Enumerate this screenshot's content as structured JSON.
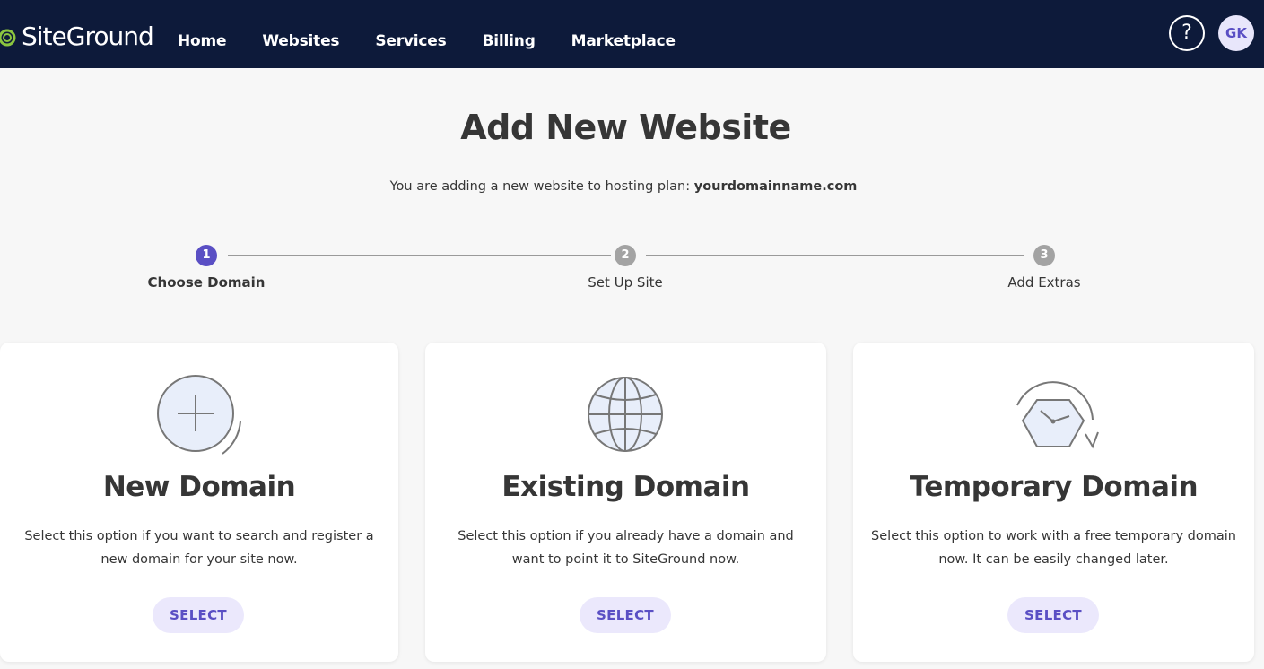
{
  "header": {
    "logo_text": "SiteGround",
    "nav": [
      "Home",
      "Websites",
      "Services",
      "Billing",
      "Marketplace"
    ],
    "help_label": "?",
    "avatar_initials": "GK"
  },
  "page": {
    "title": "Add New Website",
    "subtitle_prefix": "You are adding a new website to hosting plan: ",
    "plan_domain": "yourdomainname.com"
  },
  "steps": [
    {
      "number": "1",
      "label": "Choose Domain",
      "active": true
    },
    {
      "number": "2",
      "label": "Set Up Site",
      "active": false
    },
    {
      "number": "3",
      "label": "Add Extras",
      "active": false
    }
  ],
  "cards": [
    {
      "title": "New Domain",
      "description": "Select this option if you want to search and register a new domain for your site now.",
      "button": "SELECT",
      "icon": "plus-circle-icon"
    },
    {
      "title": "Existing Domain",
      "description": "Select this option if you already have a domain and want to point it to SiteGround now.",
      "button": "SELECT",
      "icon": "globe-icon"
    },
    {
      "title": "Temporary Domain",
      "description": "Select this option to work with a free temporary domain now. It can be easily changed later.",
      "button": "SELECT",
      "icon": "clock-icon"
    }
  ],
  "colors": {
    "header_bg": "#0d1a3a",
    "accent": "#5a4fc4",
    "step_active": "#5a4fc4",
    "step_inactive": "#a3a3a3",
    "button_bg": "#ebe8fc",
    "logo_green": "#8bc53f"
  }
}
